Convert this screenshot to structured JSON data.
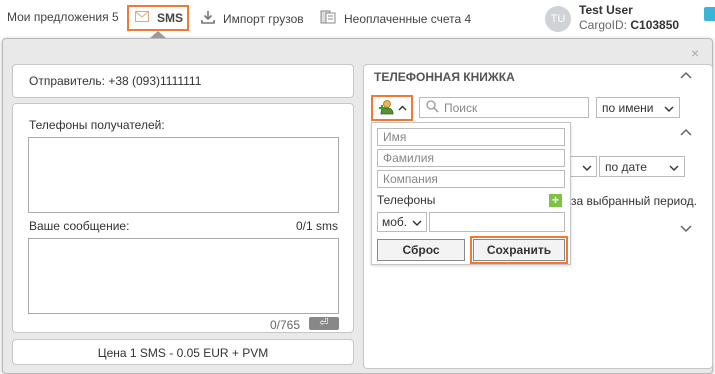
{
  "nav": {
    "offers_label": "Мои предложения 5",
    "sms_label": "SMS",
    "import_label": "Импорт грузов",
    "unpaid_label": "Неоплаченные счета 4"
  },
  "user": {
    "initials": "TU",
    "name": "Test User",
    "cargo_prefix": "CargoID: ",
    "cargo_id": "C103850"
  },
  "modal": {
    "close_glyph": "×",
    "sender_text": "Отправитель: +38 (093)1111111",
    "recipients_label": "Телефоны получателей:",
    "message_label": "Ваше сообщение:",
    "sms_count": "0/1 sms",
    "char_count": "0/765",
    "enter_glyph": "⏎",
    "price_text": "Цена 1 SMS - 0.05 EUR + PVM"
  },
  "phonebook": {
    "title": "ТЕЛЕФОННАЯ КНИЖКА",
    "search_placeholder": "Поиск",
    "sort_by_name": "по имени",
    "sort_by_date": "по дате",
    "period_text": "за выбранный период."
  },
  "add_contact": {
    "first_name_placeholder": "Имя",
    "last_name_placeholder": "Фамилия",
    "company_placeholder": "Компания",
    "phones_label": "Телефоны",
    "phone_type": "моб.",
    "reset_label": "Сброс",
    "save_label": "Сохранить"
  },
  "colors": {
    "highlight": "#f07a33",
    "add_green": "#7cc243",
    "chat_blue": "#39b5d8"
  },
  "icons": [
    "envelope-icon",
    "download-icon",
    "invoice-icon",
    "add-contact-icon",
    "search-icon",
    "chevron-up-icon",
    "chevron-down-icon",
    "close-icon",
    "plus-icon",
    "enter-icon"
  ]
}
